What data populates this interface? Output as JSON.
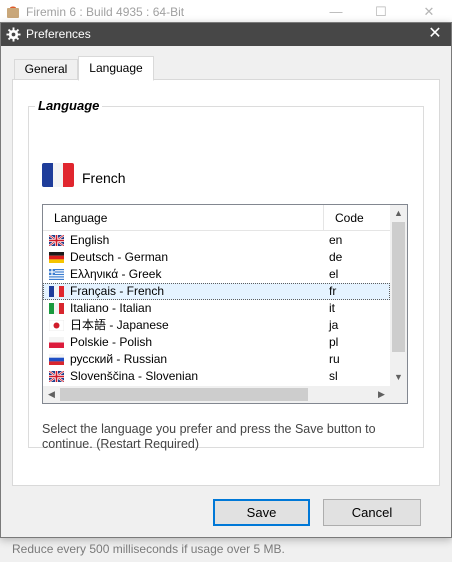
{
  "background_window": {
    "title": "Firemin 6 : Build 4935 : 64-Bit",
    "footer_text": "Reduce every 500 milliseconds if usage over 5 MB."
  },
  "dialog": {
    "title": "Preferences",
    "close_glyph": "✕"
  },
  "tabs": [
    {
      "label": "General",
      "active": false
    },
    {
      "label": "Language",
      "active": true
    }
  ],
  "group": {
    "title": "Language",
    "selected_language": "French",
    "selected_flag_icon": "flag-fr-icon"
  },
  "list": {
    "columns": [
      "Language",
      "Code"
    ],
    "rows": [
      {
        "flag": "flag-gb-icon",
        "name": "English",
        "code": "en",
        "selected": false
      },
      {
        "flag": "flag-de-icon",
        "name": "Deutsch - German",
        "code": "de",
        "selected": false
      },
      {
        "flag": "flag-gr-icon",
        "name": "Ελληνικά - Greek",
        "code": "el",
        "selected": false
      },
      {
        "flag": "flag-fr-icon",
        "name": "Français - French",
        "code": "fr",
        "selected": true
      },
      {
        "flag": "flag-it-icon",
        "name": "Italiano - Italian",
        "code": "it",
        "selected": false
      },
      {
        "flag": "flag-jp-icon",
        "name": "日本語 - Japanese",
        "code": "ja",
        "selected": false
      },
      {
        "flag": "flag-pl-icon",
        "name": "Polskie - Polish",
        "code": "pl",
        "selected": false
      },
      {
        "flag": "flag-ru-icon",
        "name": "русский - Russian",
        "code": "ru",
        "selected": false
      },
      {
        "flag": "flag-gb-icon",
        "name": "Slovenščina - Slovenian",
        "code": "sl",
        "selected": false
      }
    ]
  },
  "hint": "Select the language you prefer and press the Save button to continue. (Restart Required)",
  "buttons": {
    "save": "Save",
    "cancel": "Cancel"
  },
  "colors": {
    "title_bar": "#474747",
    "accent": "#0078d7",
    "selected_row": "#e5f3ff"
  }
}
